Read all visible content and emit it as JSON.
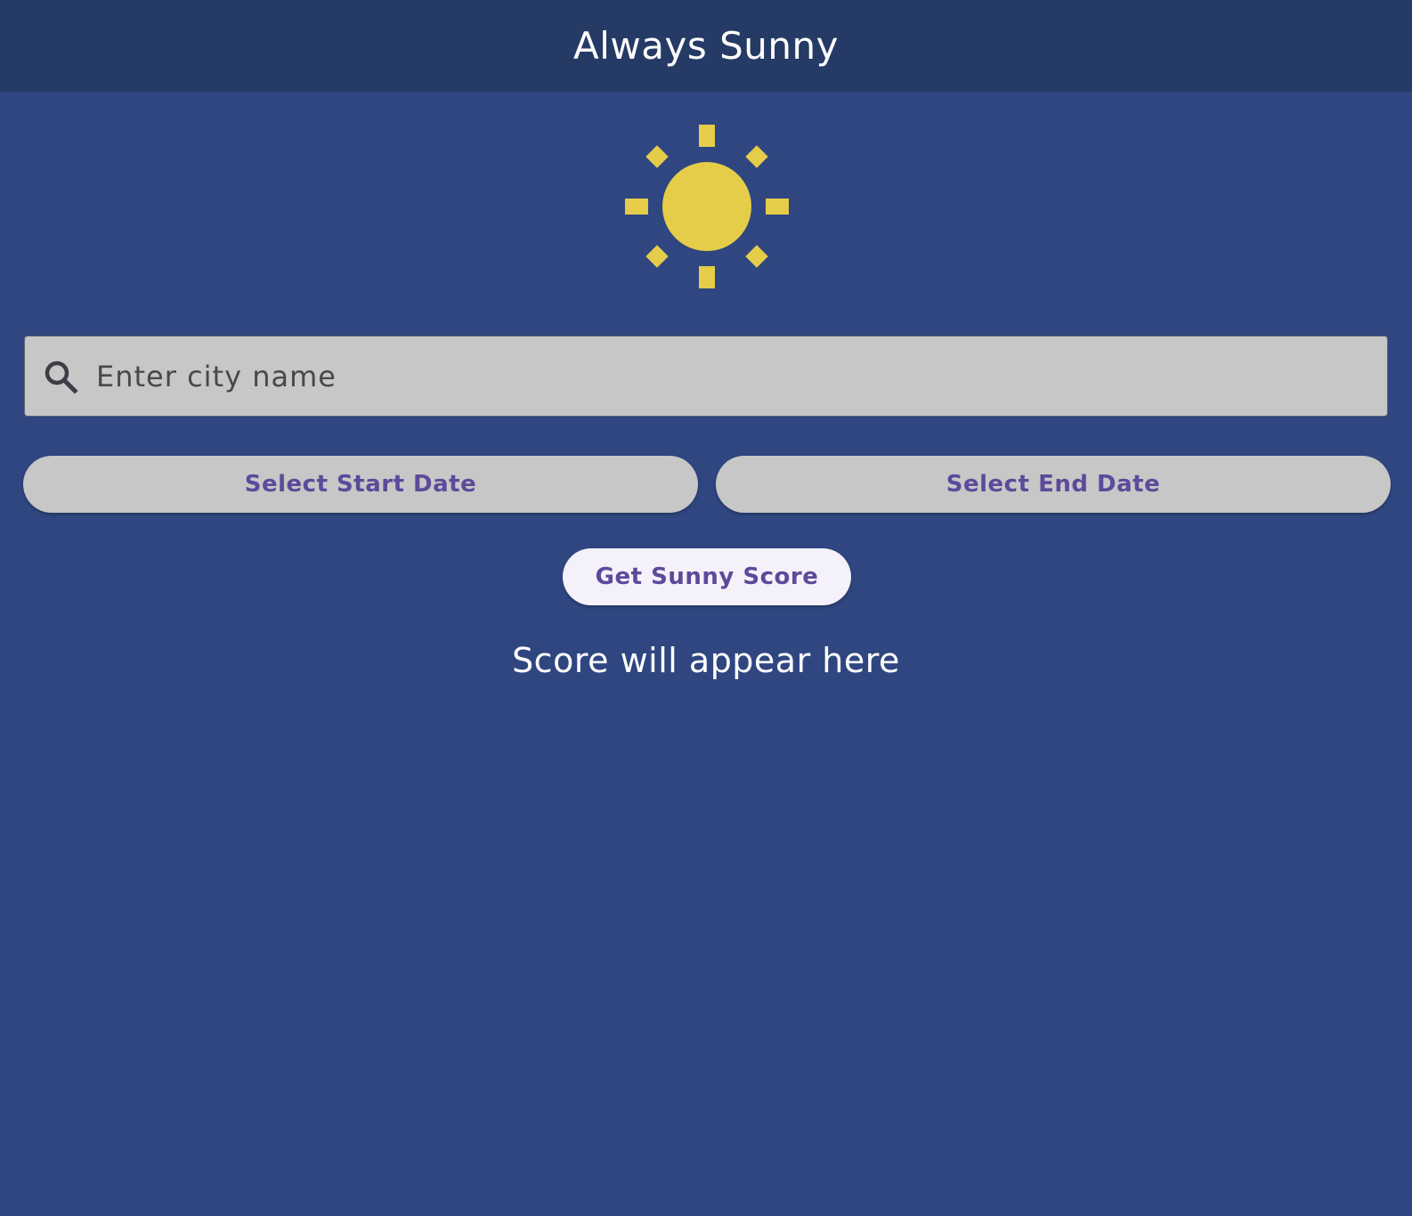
{
  "app_bar": {
    "title": "Always Sunny"
  },
  "logo": {
    "icon": "sun-icon",
    "color": "#e5cc49"
  },
  "search": {
    "icon": "search-icon",
    "placeholder": "Enter city name",
    "value": ""
  },
  "date_buttons": {
    "start_label": "Select Start Date",
    "end_label": "Select End Date"
  },
  "score_button": {
    "label": "Get Sunny Score"
  },
  "result": {
    "text": "Score will appear here"
  },
  "colors": {
    "background": "#2f4680",
    "app_bar": "#263a66",
    "button_text": "#5c4a9a",
    "input_fill": "#c7c7c7"
  }
}
